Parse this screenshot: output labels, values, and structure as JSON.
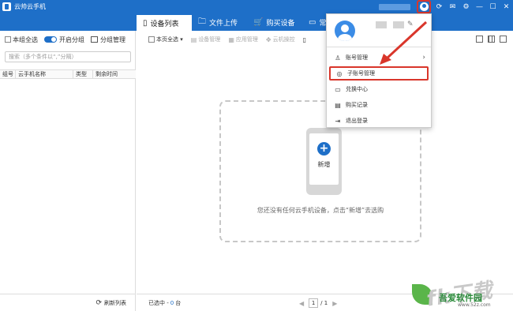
{
  "window": {
    "title": "云帅云手机",
    "controls": [
      "user-icon",
      "refresh-icon",
      "mail-icon",
      "gear-icon",
      "minimize-icon",
      "maximize-icon",
      "close-icon"
    ]
  },
  "tabs": [
    {
      "label": "设备列表",
      "icon": "phone-icon",
      "active": true
    },
    {
      "label": "文件上传",
      "icon": "folder-icon",
      "active": false
    },
    {
      "label": "购买设备",
      "icon": "cart-icon",
      "active": false
    },
    {
      "label": "常",
      "icon": "ticket-icon",
      "active": false
    }
  ],
  "left": {
    "select_all": "本组全选",
    "open_group_label": "开启分组",
    "group_manage": "分组管理",
    "search_placeholder": "搜索（多个条件以“,”分隔）",
    "columns": [
      "组号",
      "云手机名称",
      "类型",
      "剩余时间"
    ],
    "refresh": "刷新列表"
  },
  "toolbar": {
    "select_page": "本页全选",
    "items": [
      "设备管理",
      "应用管理",
      "云机操控"
    ]
  },
  "empty": {
    "new_label": "新增",
    "message": "您还没有任何云手机设备，点击“新增”去选购"
  },
  "footer": {
    "selected_prefix": "已选中 -",
    "selected_count": "0",
    "selected_suffix": "台",
    "page_current": "1",
    "page_total": "/ 1"
  },
  "dropdown": {
    "items": [
      {
        "label": "账号管理",
        "icon": "account-icon",
        "has_submenu": true
      },
      {
        "label": "子账号管理",
        "icon": "sub-account-icon",
        "highlighted": true
      },
      {
        "label": "兑换中心",
        "icon": "ticket-icon"
      },
      {
        "label": "购买记录",
        "icon": "document-icon"
      },
      {
        "label": "退出登录",
        "icon": "logout-icon"
      }
    ]
  },
  "watermark": {
    "big": "fk下载",
    "name": "吾爱软件园",
    "url": "www.52z.com"
  },
  "colors": {
    "brand": "#1e6fc8",
    "highlight": "#d9362b"
  }
}
